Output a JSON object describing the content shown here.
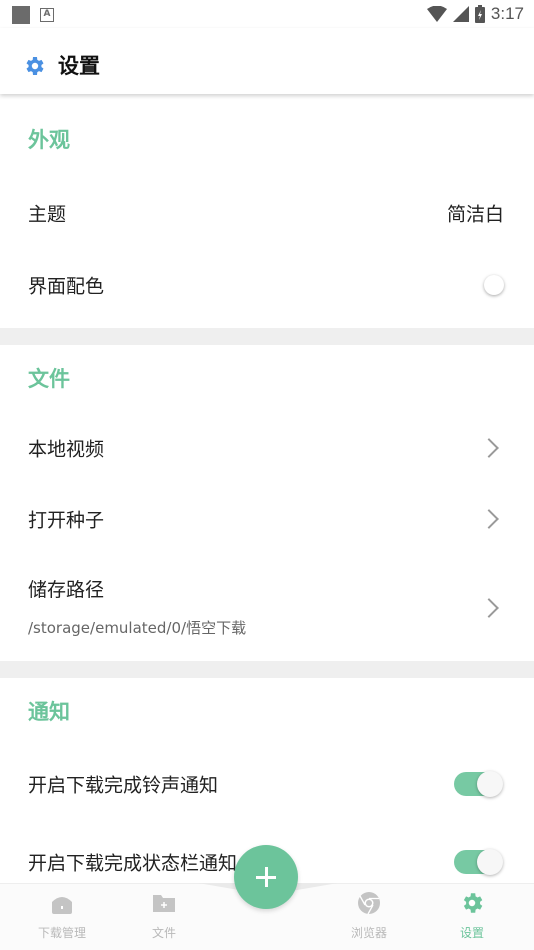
{
  "status_bar": {
    "time": "3:17"
  },
  "app_bar": {
    "title": "设置",
    "icon": "gear-icon"
  },
  "sections": {
    "appearance": {
      "header": "外观",
      "theme": {
        "label": "主题",
        "value": "简洁白"
      },
      "color_scheme": {
        "label": "界面配色",
        "selected": false
      }
    },
    "files": {
      "header": "文件",
      "local_video": {
        "label": "本地视频"
      },
      "open_seed": {
        "label": "打开种子"
      },
      "storage_path": {
        "label": "储存路径",
        "value": "/storage/emulated/0/悟空下载"
      }
    },
    "notifications": {
      "header": "通知",
      "ringtone": {
        "label": "开启下载完成铃声通知",
        "enabled": true
      },
      "status_bar": {
        "label": "开启下载完成状态栏通知",
        "enabled": true
      }
    }
  },
  "bottom_nav": {
    "items": [
      {
        "label": "下载管理",
        "icon": "home-icon",
        "active": false
      },
      {
        "label": "文件",
        "icon": "folder-icon",
        "active": false
      },
      {
        "label": "浏览器",
        "icon": "browser-icon",
        "active": false
      },
      {
        "label": "设置",
        "icon": "gear-icon",
        "active": true
      }
    ],
    "fab_icon": "plus-icon"
  },
  "colors": {
    "accent": "#6cc49b",
    "toggle_on": "#77c9a3",
    "inactive_nav": "#b9b9b9",
    "divider": "#efefef"
  }
}
